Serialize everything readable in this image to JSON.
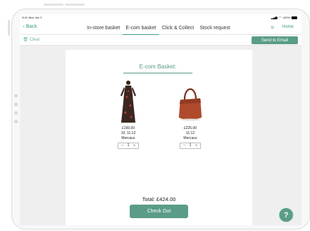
{
  "status": {
    "time": "9:41",
    "date": "Mon Jun 3",
    "battery": "100%"
  },
  "nav": {
    "back_label": "Back",
    "tabs": [
      {
        "label": "In-store basket"
      },
      {
        "label": "E-com basket"
      },
      {
        "label": "Click & Collect"
      },
      {
        "label": "Stock request"
      }
    ],
    "home_label": "Home"
  },
  "actions": {
    "clear_label": "Clear",
    "send_label": "Send to Email"
  },
  "basket": {
    "heading": "E-com Basket:",
    "products": [
      {
        "price": "£199.00",
        "size": "10, 11:12",
        "brand": "Mercaux",
        "qty": "1"
      },
      {
        "price": "£225.00",
        "size": "11:12",
        "brand": "Mercaux",
        "qty": "1"
      }
    ],
    "total": "Total:  £424.00",
    "checkout_label": "Check Out"
  },
  "help_label": "?",
  "colors": {
    "accent": "#5a9c88",
    "link": "#3a9d8c"
  }
}
